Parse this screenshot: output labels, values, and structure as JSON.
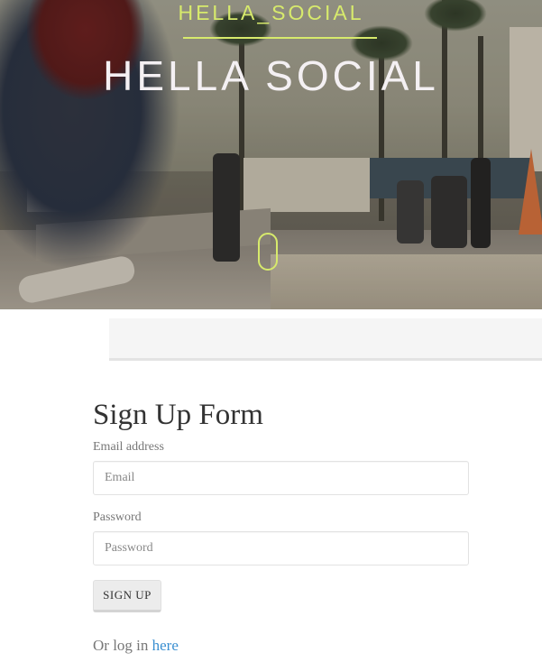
{
  "hero": {
    "brand_small": "HELLA_SOCIAL",
    "brand_big": "HELLA SOCIAL",
    "colors": {
      "accent": "#d7ea6c",
      "title": "#f4f0f3"
    }
  },
  "navbar": {},
  "form": {
    "title": "Sign Up Form",
    "email_label": "Email address",
    "email_placeholder": "Email",
    "email_value": "",
    "password_label": "Password",
    "password_placeholder": "Password",
    "password_value": "",
    "submit_label": "SIGN UP",
    "login_prefix": "Or log in ",
    "login_link": "here",
    "colors": {
      "link": "#3a8fd1",
      "label": "#777777"
    }
  }
}
